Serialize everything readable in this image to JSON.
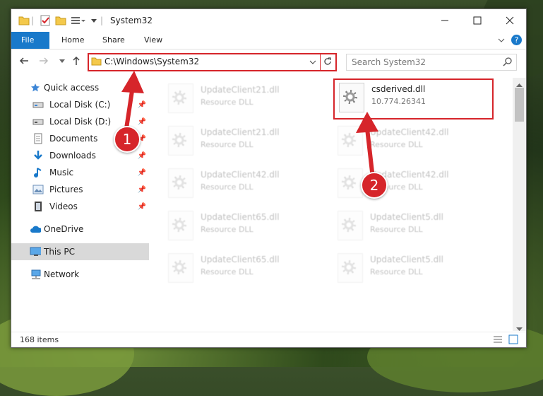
{
  "window": {
    "title": "System32"
  },
  "ribbon": {
    "tabs": [
      "File",
      "Home",
      "Share",
      "View"
    ]
  },
  "address": {
    "path": "C:\\Windows\\System32"
  },
  "search": {
    "placeholder": "Search System32"
  },
  "nav": {
    "items": [
      {
        "label": "Quick access",
        "icon": "star-icon"
      },
      {
        "label": "Local Disk (C:)",
        "icon": "drive-icon",
        "pinned": true
      },
      {
        "label": "Local Disk (D:)",
        "icon": "drive-icon",
        "pinned": true
      },
      {
        "label": "Documents",
        "icon": "document-icon",
        "pinned": true
      },
      {
        "label": "Downloads",
        "icon": "download-icon",
        "pinned": true
      },
      {
        "label": "Music",
        "icon": "music-icon",
        "pinned": true
      },
      {
        "label": "Pictures",
        "icon": "picture-icon",
        "pinned": true
      },
      {
        "label": "Videos",
        "icon": "video-icon",
        "pinned": true
      },
      {
        "label": "OneDrive",
        "icon": "cloud-icon"
      },
      {
        "label": "This PC",
        "icon": "computer-icon",
        "selected": true
      },
      {
        "label": "Network",
        "icon": "network-icon"
      }
    ]
  },
  "files": [
    {
      "name": "UpdateClient21.dll",
      "type": "Resource DLL"
    },
    {
      "name": "csderived.dll",
      "type": "10.774.26341",
      "highlighted": true
    },
    {
      "name": "UpdateClient21.dll",
      "type": "Resource DLL"
    },
    {
      "name": "UpdateClient42.dll",
      "type": "Resource DLL"
    },
    {
      "name": "UpdateClient42.dll",
      "type": "Resource DLL"
    },
    {
      "name": "UpdateClient42.dll",
      "type": "Resource DLL"
    },
    {
      "name": "UpdateClient65.dll",
      "type": "Resource DLL"
    },
    {
      "name": "UpdateClient5.dll",
      "type": "Resource DLL"
    },
    {
      "name": "UpdateClient65.dll",
      "type": "Resource DLL"
    },
    {
      "name": "UpdateClient5.dll",
      "type": "Resource DLL"
    }
  ],
  "status": {
    "item_count": "168 items"
  },
  "annotations": {
    "step1": "1",
    "step2": "2"
  },
  "colors": {
    "accent": "#1979ca",
    "highlight": "#d6252a"
  }
}
